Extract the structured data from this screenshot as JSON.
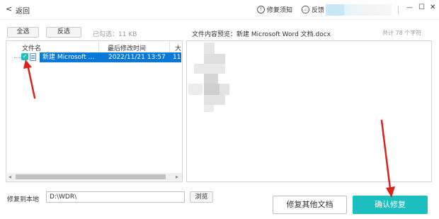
{
  "titlebar": {
    "back_glyph": "<",
    "back_label": "返回",
    "repair_notes_glyph": "!",
    "repair_notes_label": "修复须知",
    "feedback_glyph": "…",
    "feedback_label": "反馈",
    "minimize_glyph": "—",
    "maximize_glyph": "☐",
    "close_glyph": "✕"
  },
  "selection": {
    "select_all": "全选",
    "invert": "反选",
    "selected_info": "已勾选：11 KB"
  },
  "preview": {
    "title": "文件内容预览：新建 Microsoft Word 文档.docx",
    "char_count": "共计 78 个字符"
  },
  "table": {
    "columns": [
      "文件名",
      "最后修改时间",
      "大"
    ],
    "rows": [
      {
        "name": "新建 Microsoft ...",
        "modified": "2022/11/21 13:57",
        "size": "11"
      }
    ]
  },
  "scrollbar": {
    "left_arrow": "◂",
    "right_arrow": "▸"
  },
  "footer": {
    "save_label": "修复到本地",
    "path_value": "D:\\WDR\\",
    "browse": "浏览",
    "repair_other": "修复其他文档",
    "confirm_repair": "确认修复"
  },
  "colors": {
    "accent": "#1cbfbf",
    "selection": "#0a78d7",
    "arrow": "#d9231d"
  }
}
